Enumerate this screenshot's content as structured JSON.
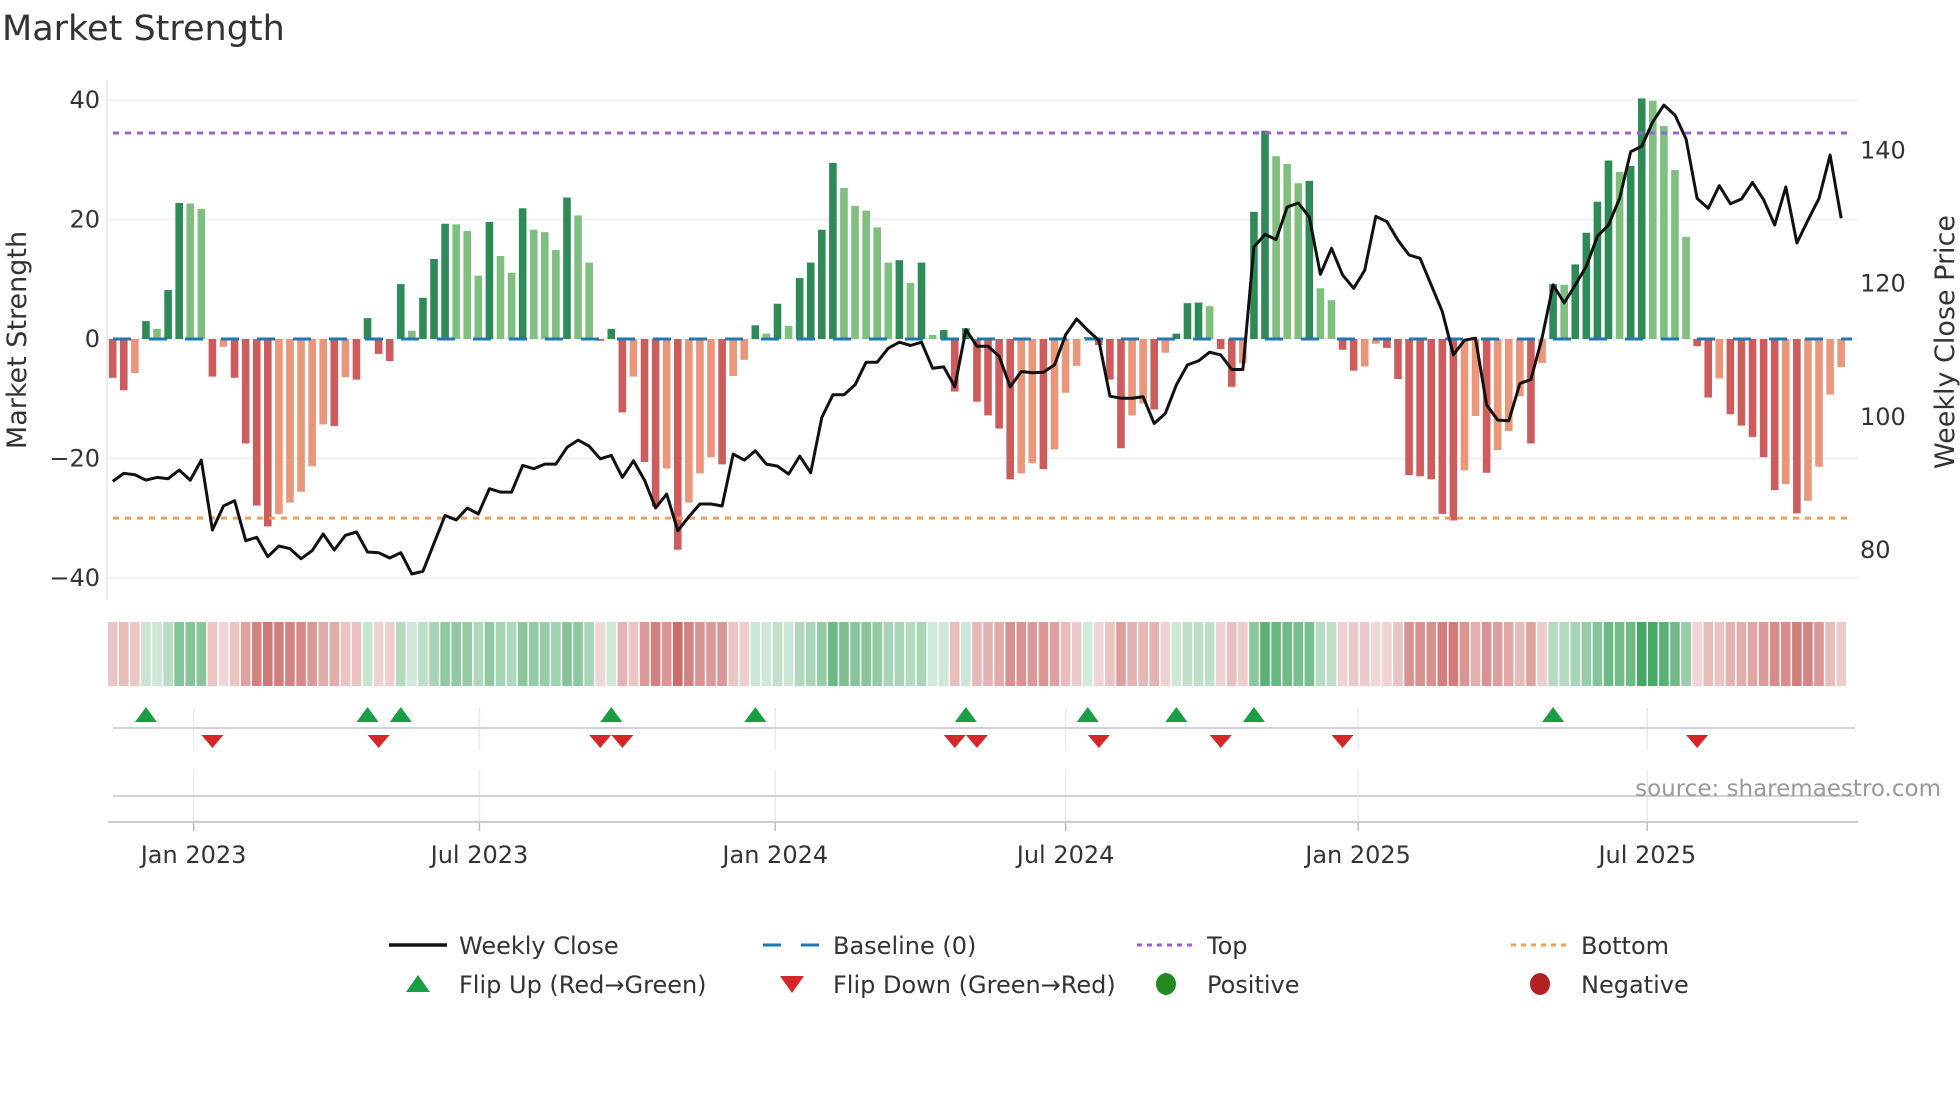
{
  "chart_data": {
    "type": "bar",
    "title": "Market Strength",
    "ylabel": "Market Strength",
    "y2label": "Weekly Close Price",
    "ylim": [
      -42,
      44
    ],
    "y2lim": [
      80,
      150
    ],
    "yticks": [
      {
        "v": -40,
        "label": "−40"
      },
      {
        "v": -20,
        "label": "−20"
      },
      {
        "v": 0,
        "label": "0"
      },
      {
        "v": 20,
        "label": "20"
      },
      {
        "v": 40,
        "label": "40"
      }
    ],
    "y2ticks": [
      {
        "v": 80,
        "label": "80"
      },
      {
        "v": 100,
        "label": "100"
      },
      {
        "v": 120,
        "label": "120"
      },
      {
        "v": 140,
        "label": "140"
      }
    ],
    "x_unit": "week index",
    "x_ticks": [
      {
        "label": "Jan 2023",
        "week": 7.3
      },
      {
        "label": "Jul 2023",
        "week": 33.1
      },
      {
        "label": "Jan 2024",
        "week": 59.8
      },
      {
        "label": "Jul 2024",
        "week": 86.0
      },
      {
        "label": "Jan 2025",
        "week": 112.4
      },
      {
        "label": "Jul 2025",
        "week": 138.5
      }
    ],
    "grid": true,
    "top_level": 34.5,
    "bottom_level": -30,
    "baseline": 0,
    "strength": [
      -6.5,
      -8.6,
      -5.7,
      3.0,
      1.7,
      8.2,
      22.8,
      22.7,
      21.8,
      -6.3,
      -1.3,
      -6.5,
      -17.5,
      -27.9,
      -31.4,
      -29.3,
      -27.4,
      -25.6,
      -21.3,
      -14.3,
      -14.6,
      -6.4,
      -6.8,
      3.5,
      -2.5,
      -3.7,
      9.2,
      1.4,
      6.9,
      13.4,
      19.3,
      19.2,
      18.1,
      10.6,
      19.6,
      13.9,
      11.1,
      21.9,
      18.3,
      17.9,
      14.9,
      23.7,
      20.7,
      12.8,
      -0.3,
      1.7,
      -12.3,
      -6.3,
      -20.6,
      -28.1,
      -21.7,
      -35.3,
      -27.4,
      -22.5,
      -19.8,
      -21.0,
      -6.2,
      -3.5,
      2.3,
      0.9,
      5.9,
      2.2,
      10.2,
      12.8,
      18.3,
      29.5,
      25.3,
      22.3,
      21.5,
      18.7,
      12.8,
      13.2,
      9.4,
      12.8,
      0.7,
      1.5,
      -8.8,
      1.8,
      -10.5,
      -12.8,
      -15.0,
      -23.5,
      -22.5,
      -20.8,
      -21.8,
      -18.5,
      -9.0,
      -4.5,
      0.3,
      -1.0,
      -6.8,
      -18.3,
      -12.8,
      -10.8,
      -11.8,
      -2.3,
      0.9,
      6.0,
      6.1,
      5.5,
      -1.7,
      -8.0,
      -4.1,
      21.3,
      34.9,
      30.6,
      29.3,
      26.1,
      26.5,
      8.5,
      6.5,
      -1.8,
      -5.3,
      -4.6,
      -0.8,
      -1.5,
      -6.7,
      -22.8,
      -23.0,
      -23.5,
      -29.3,
      -30.4,
      -22.0,
      -12.9,
      -22.4,
      -18.6,
      -15.4,
      -9.6,
      -17.5,
      -4.0,
      9.2,
      9.1,
      12.5,
      17.8,
      23.0,
      29.9,
      28.0,
      29.0,
      41.0,
      39.9,
      35.7,
      28.3,
      17.1,
      -1.2,
      -9.8,
      -6.6,
      -12.6,
      -14.5,
      -16.4,
      -19.8,
      -25.3,
      -24.3,
      -29.2,
      -27.1,
      -21.4,
      -9.3,
      -4.7
    ],
    "weekly_close": [
      90.3,
      91.5,
      91.3,
      90.5,
      90.9,
      90.7,
      92.0,
      90.5,
      93.5,
      83.0,
      86.6,
      87.4,
      81.4,
      81.9,
      79.0,
      80.6,
      80.2,
      78.7,
      79.9,
      82.4,
      80.0,
      82.2,
      82.7,
      79.7,
      79.6,
      78.8,
      79.6,
      76.4,
      76.8,
      81.0,
      85.2,
      84.5,
      86.3,
      85.4,
      89.2,
      88.7,
      88.7,
      92.7,
      92.2,
      92.9,
      92.9,
      95.4,
      96.5,
      95.6,
      93.7,
      94.2,
      90.9,
      93.4,
      90.5,
      86.3,
      88.4,
      82.9,
      85.0,
      86.9,
      86.9,
      86.6,
      94.4,
      93.5,
      94.9,
      92.9,
      92.6,
      91.4,
      94.1,
      91.6,
      99.9,
      103.3,
      103.3,
      104.8,
      108.2,
      108.2,
      110.3,
      111.2,
      110.7,
      111.2,
      107.3,
      107.5,
      104.5,
      113.1,
      110.6,
      110.6,
      109.1,
      104.5,
      106.8,
      106.6,
      106.7,
      107.8,
      112.3,
      114.7,
      113.0,
      111.5,
      103.1,
      102.8,
      102.8,
      103.0,
      99.0,
      100.5,
      104.8,
      107.8,
      108.4,
      109.7,
      109.3,
      107.1,
      107.1,
      125.5,
      127.4,
      126.6,
      131.5,
      132.1,
      130.0,
      121.4,
      125.3,
      121.3,
      119.3,
      122.0,
      130.1,
      129.3,
      126.5,
      124.3,
      123.8,
      119.8,
      115.8,
      109.3,
      111.5,
      111.8,
      101.8,
      99.5,
      99.4,
      105.0,
      105.6,
      111.8,
      119.8,
      117.1,
      119.8,
      122.6,
      127.1,
      128.8,
      132.8,
      139.8,
      140.6,
      144.3,
      146.8,
      145.3,
      141.7,
      132.8,
      131.3,
      134.7,
      132.0,
      132.7,
      135.2,
      132.6,
      128.8,
      134.5,
      126.1,
      129.5,
      132.8,
      139.3,
      129.8
    ],
    "legend": {
      "placement": "bottom",
      "items": [
        {
          "label": "Weekly Close",
          "kind": "line"
        },
        {
          "label": "Baseline (0)",
          "kind": "dash"
        },
        {
          "label": "Top",
          "kind": "dot-purple"
        },
        {
          "label": "Bottom",
          "kind": "dot-orange"
        },
        {
          "label": "Flip Up (Red→Green)",
          "kind": "tri-up"
        },
        {
          "label": "Flip Down (Green→Red)",
          "kind": "tri-down"
        },
        {
          "label": "Positive",
          "kind": "circle-green"
        },
        {
          "label": "Negative",
          "kind": "circle-red"
        }
      ]
    },
    "source": "source: sharemaestro.com",
    "colors": {
      "green_dark": "#2e8b57",
      "green_light": "#7fbf7f",
      "red_dark": "#cd5c5c",
      "red_light": "#e9967a",
      "strip_green": "#3aa05a",
      "strip_red": "#c0504d",
      "flip_up": "#1a9e45",
      "flip_down": "#d62728",
      "positive": "#228b22",
      "negative": "#b22222",
      "top": "#9b5fd6",
      "bottom": "#f0a05a",
      "baseline": "#1f77b4",
      "close": "#111111"
    }
  }
}
